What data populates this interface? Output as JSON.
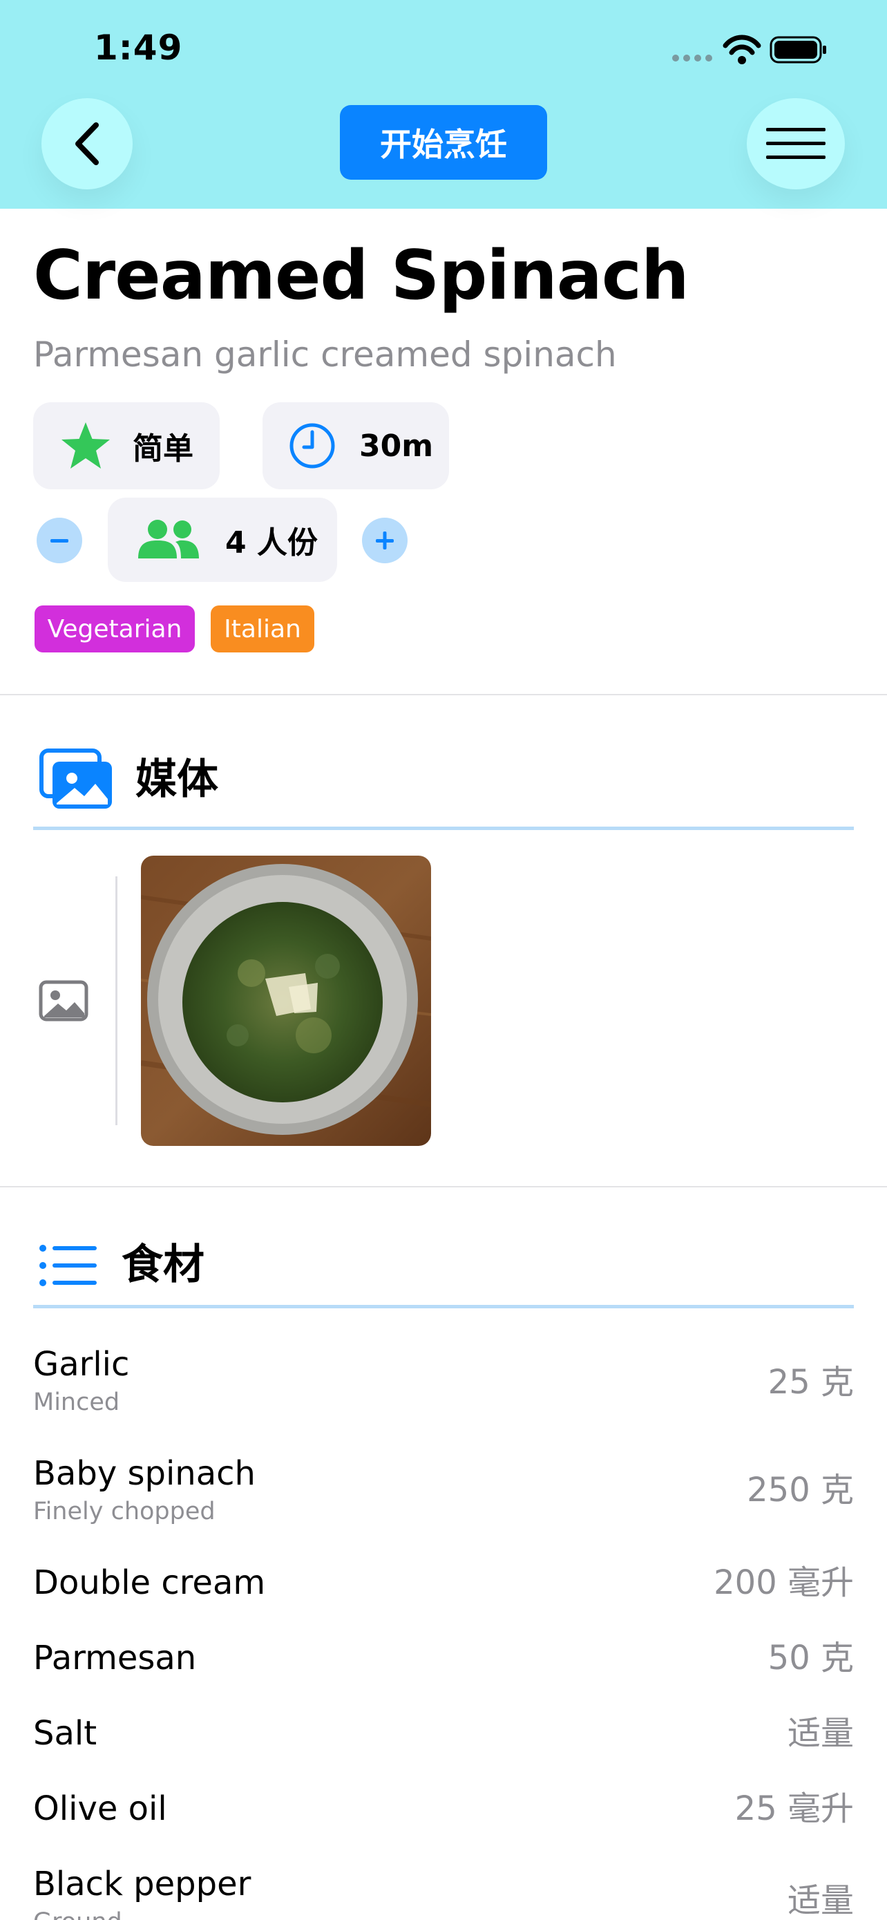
{
  "status_bar": {
    "time": "1:49"
  },
  "header": {
    "start_cooking_label": "开始烹饪",
    "bg_color": "#9aeef4",
    "accent_color": "#0a84ff"
  },
  "recipe": {
    "title": "Creamed Spinach",
    "subtitle": "Parmesan garlic creamed spinach",
    "difficulty": "简单",
    "time": "30m",
    "servings": "4 人份",
    "tags": [
      {
        "label": "Vegetarian",
        "color": "#d22fdc"
      },
      {
        "label": "Italian",
        "color": "#f98d20"
      }
    ]
  },
  "media": {
    "section_title": "媒体"
  },
  "ingredients": {
    "section_title": "食材",
    "items": [
      {
        "name": "Garlic",
        "note": "Minced",
        "quantity": "25 克"
      },
      {
        "name": "Baby spinach",
        "note": "Finely chopped",
        "quantity": "250 克"
      },
      {
        "name": "Double cream",
        "note": "",
        "quantity": "200 毫升"
      },
      {
        "name": "Parmesan",
        "note": "",
        "quantity": "50 克"
      },
      {
        "name": "Salt",
        "note": "",
        "quantity": "适量"
      },
      {
        "name": "Olive oil",
        "note": "",
        "quantity": "25 毫升"
      },
      {
        "name": "Black pepper",
        "note": "Ground",
        "quantity": "适量"
      }
    ]
  }
}
